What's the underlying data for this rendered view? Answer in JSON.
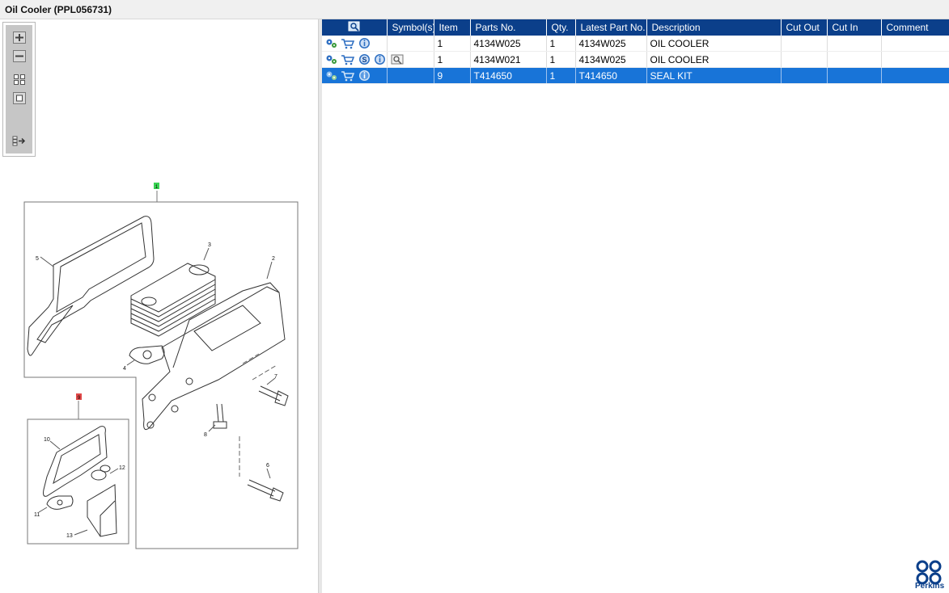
{
  "window": {
    "title": "Oil Cooler (PPL056731)"
  },
  "toolbox": {
    "buttons": [
      {
        "name": "zoom-in-icon"
      },
      {
        "name": "zoom-out-icon"
      },
      {
        "name": "fit-all-icon"
      },
      {
        "name": "actual-size-icon"
      },
      {
        "name": "toggle-list-icon"
      }
    ]
  },
  "diagram": {
    "group_marker_1": "1",
    "group_marker_9": "9",
    "callouts": {
      "c1": "2",
      "c2": "3",
      "c3": "5",
      "c4": "4",
      "c5": "7",
      "c6": "8",
      "c7": "6",
      "c8": "10",
      "c9": "12",
      "c10": "11",
      "c11": "13"
    }
  },
  "table": {
    "columns": [
      "",
      "Symbol(s)",
      "Item",
      "Parts No.",
      "Qty.",
      "Latest Part No.",
      "Description",
      "Cut Out",
      "Cut In",
      "Comment"
    ],
    "rows": [
      {
        "item": "1",
        "parts_no": "4134W025",
        "qty": "1",
        "latest": "4134W025",
        "description": "OIL COOLER",
        "cut_out": "",
        "cut_in": "",
        "comment": ""
      },
      {
        "item": "1",
        "parts_no": "4134W021",
        "qty": "1",
        "latest": "4134W025",
        "description": "OIL COOLER",
        "cut_out": "",
        "cut_in": "",
        "comment": ""
      },
      {
        "item": "9",
        "parts_no": "T414650",
        "qty": "1",
        "latest": "T414650",
        "description": "SEAL KIT",
        "cut_out": "",
        "cut_in": "",
        "comment": ""
      }
    ],
    "selected_row": 2
  },
  "brand": {
    "name": "Perkins",
    "color": "#0b3f8a"
  },
  "colors": {
    "header_bg": "#0b3f8a",
    "selected_row": "#1874d8",
    "marker_green": "#39d353",
    "marker_red": "#e04848"
  }
}
